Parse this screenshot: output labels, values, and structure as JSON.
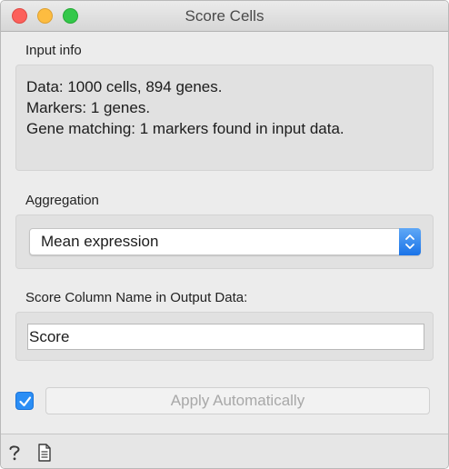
{
  "window": {
    "title": "Score Cells"
  },
  "input_info": {
    "label": "Input info",
    "lines": [
      "Data: 1000 cells, 894 genes.",
      "Markers: 1 genes.",
      "Gene matching: 1 markers found in input data."
    ]
  },
  "aggregation": {
    "label": "Aggregation",
    "selected": "Mean expression"
  },
  "score_column": {
    "label": "Score Column Name in Output Data:",
    "value": "Score"
  },
  "apply": {
    "checked": true,
    "label": "Apply Automatically"
  },
  "statusbar": {
    "help_icon": "question-mark-icon",
    "report_icon": "document-icon"
  },
  "colors": {
    "accent": "#2b8ef5",
    "close": "#fc605b",
    "minimize": "#fdbc40",
    "zoom": "#34c84a"
  }
}
